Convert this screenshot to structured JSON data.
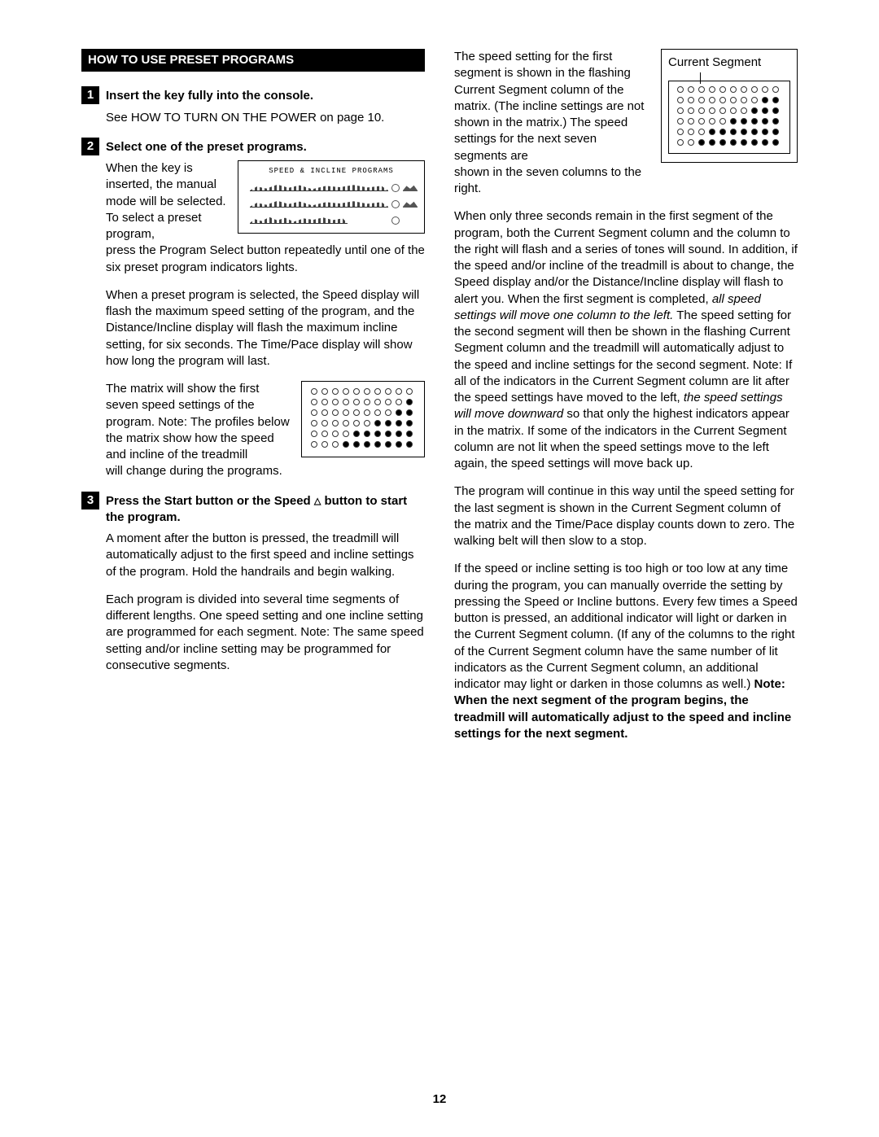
{
  "sectionHeader": "HOW TO USE PRESET PROGRAMS",
  "panelLabel": "SPEED & INCLINE PROGRAMS",
  "currentSegmentLabel": "Current Segment",
  "pageNumber": "12",
  "steps": {
    "s1": {
      "num": "1",
      "title": "Insert the key fully into the console.",
      "p1": "See HOW TO TURN ON THE POWER on page 10."
    },
    "s2": {
      "num": "2",
      "title": "Select one of the preset programs.",
      "p1": "When the key is inserted, the manual mode will be selected. To select a preset program,",
      "p1b": "press the Program Select button repeatedly until one of the six preset program indicators lights.",
      "p2": "When a preset program is selected, the Speed display will flash the maximum speed setting of the program, and the Distance/Incline display will flash the maximum incline setting, for six seconds. The Time/Pace display will show how long the program will last.",
      "p3a": "The matrix will show the first seven speed settings of the program. Note: The profiles below the matrix show how the speed and incline of the treadmill",
      "p3b": "will change during the programs."
    },
    "s3": {
      "num": "3",
      "titleA": "Press the Start button or the Speed ",
      "titleB": " button to start the program.",
      "p1": "A moment after the button is pressed, the treadmill will automatically adjust to the first speed and incline settings of the program. Hold the handrails and begin walking.",
      "p2": "Each program is divided into several time segments of different lengths. One speed setting and one incline setting are programmed for each segment. Note: The same speed setting and/or incline setting may be programmed for consecutive segments."
    }
  },
  "rightCol": {
    "p1a": "The speed setting for the first segment is shown in the flashing Current Segment column of the matrix. (The incline settings are not shown in the matrix.) The speed settings for the next seven segments are",
    "p1b": "shown in the seven columns to the right.",
    "p2a": "When only three seconds remain in the first segment of the program, both the Current Segment column and the column to the right will flash and a series of tones will sound. In addition, if the speed and/or incline of the treadmill is about to change, the Speed display and/or the Distance/Incline display will flash to alert you. When the first segment is completed, ",
    "p2i1": "all speed settings will move one column to the left.",
    "p2b": " The speed setting for the second segment will then be shown in the flashing Current Segment column and the treadmill will automatically adjust to the speed and incline settings for the second segment. Note: If all of the indicators in the Current Segment column are lit after the speed settings have moved to the left, ",
    "p2i2": "the speed settings will move downward",
    "p2c": " so that only the highest indicators appear in the matrix. If some of the indicators in the Current Segment column are not lit when the speed settings move to the left again, the speed settings will move back up.",
    "p3": "The program will continue in this way until the speed setting for the last segment is shown in the Current Segment column of the matrix and the Time/Pace display counts down to zero. The walking belt will then slow to a stop.",
    "p4a": "If the speed or incline setting is too high or too low at any time during the program, you can manually override the setting by pressing the Speed or Incline buttons. Every few times a Speed button is pressed, an additional indicator will light or darken in the Current Segment column. (If any of the columns to the right of the Current Segment column have the same number of lit indicators as the Current Segment column, an additional indicator may light or darken in those columns as well.) ",
    "p4b": "Note: When the next segment of the program begins, the treadmill will automatically adjust to the speed and incline settings for the next segment."
  },
  "matrix1": [
    [
      0,
      0,
      0,
      0,
      0,
      0,
      0,
      0,
      0,
      0
    ],
    [
      0,
      0,
      0,
      0,
      0,
      0,
      0,
      0,
      0,
      1
    ],
    [
      0,
      0,
      0,
      0,
      0,
      0,
      0,
      0,
      1,
      1
    ],
    [
      0,
      0,
      0,
      0,
      0,
      0,
      1,
      1,
      1,
      1
    ],
    [
      0,
      0,
      0,
      0,
      1,
      1,
      1,
      1,
      1,
      1
    ],
    [
      0,
      0,
      0,
      1,
      1,
      1,
      1,
      1,
      1,
      1
    ]
  ],
  "matrix2": [
    [
      0,
      0,
      0,
      0,
      0,
      0,
      0,
      0,
      0,
      0
    ],
    [
      0,
      0,
      0,
      0,
      0,
      0,
      0,
      0,
      1,
      1
    ],
    [
      0,
      0,
      0,
      0,
      0,
      0,
      0,
      1,
      1,
      1
    ],
    [
      0,
      0,
      0,
      0,
      0,
      1,
      1,
      1,
      1,
      1
    ],
    [
      0,
      0,
      0,
      1,
      1,
      1,
      1,
      1,
      1,
      1
    ],
    [
      0,
      0,
      1,
      1,
      1,
      1,
      1,
      1,
      1,
      1
    ]
  ]
}
